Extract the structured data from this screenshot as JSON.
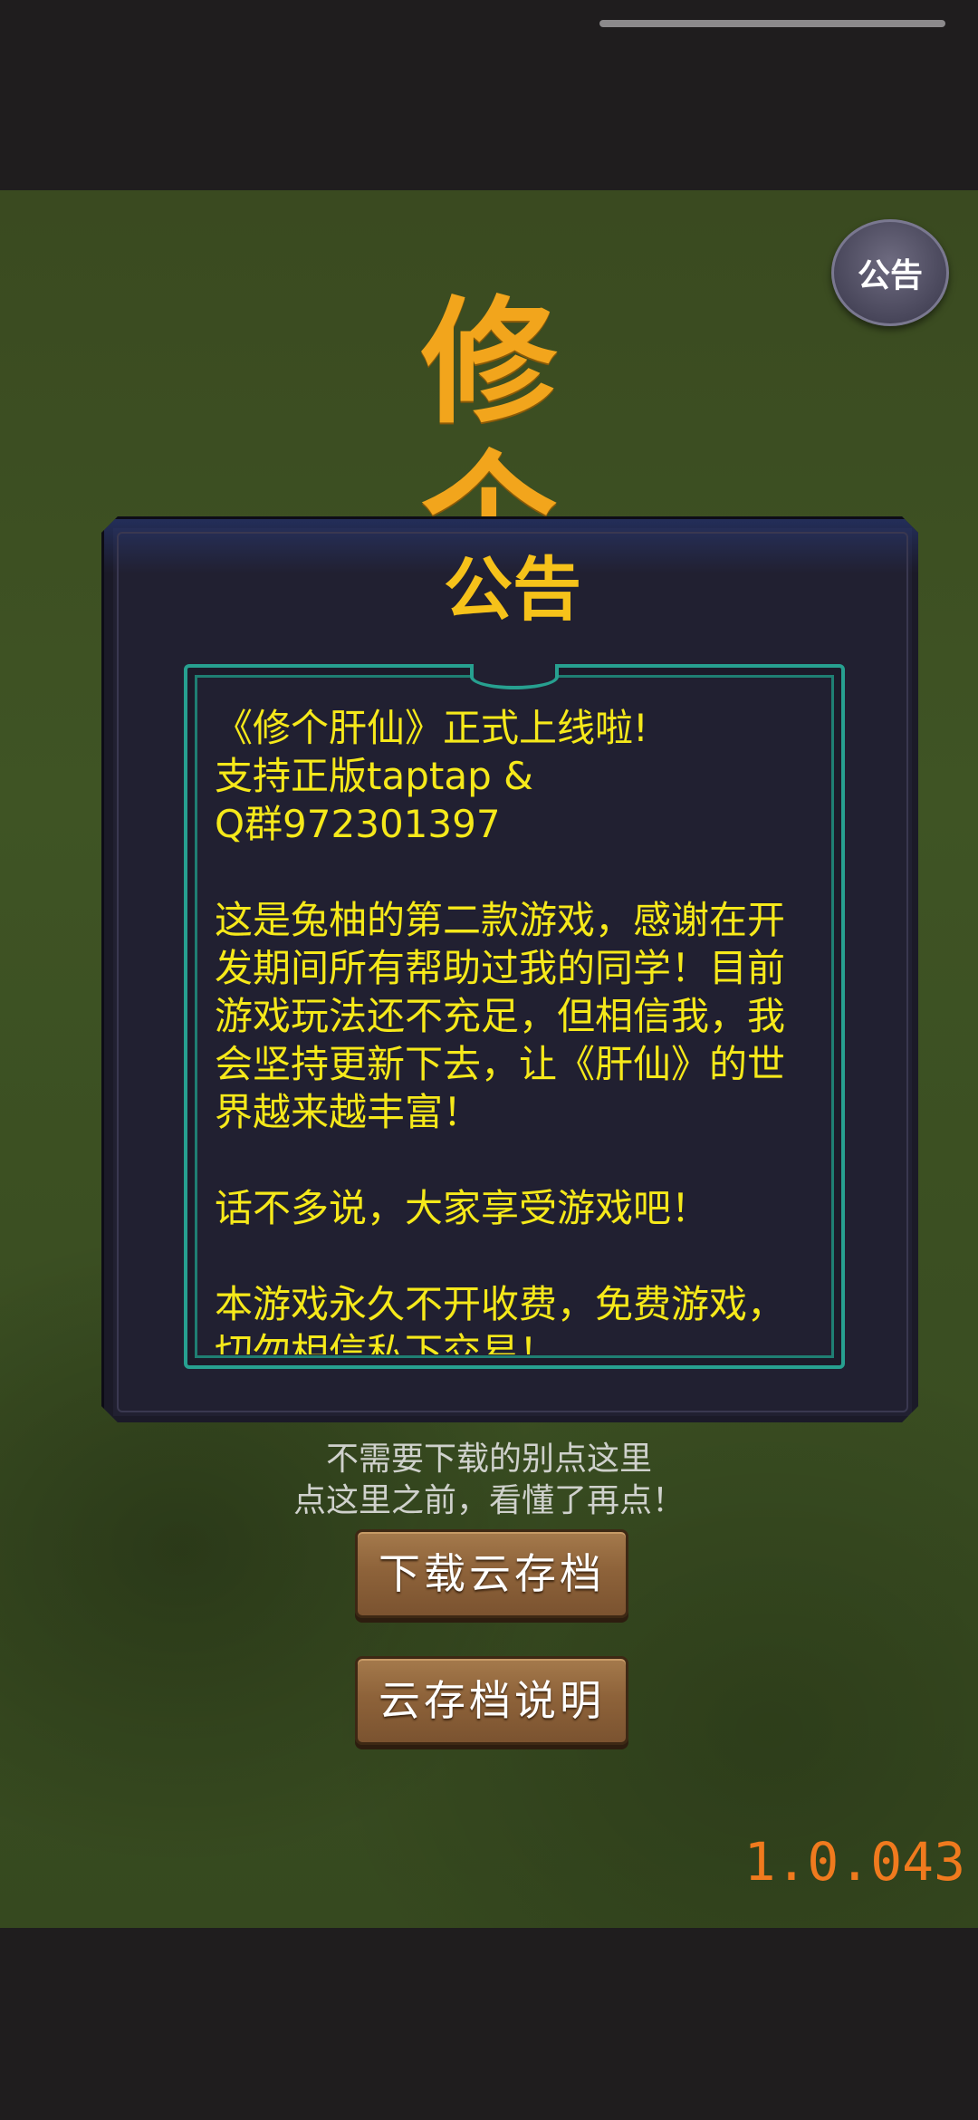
{
  "game": {
    "title_chars": "修个",
    "notice_button_label": "公告",
    "version": "1.0.043"
  },
  "notice_panel": {
    "title": "公告",
    "body": "《修个肝仙》正式上线啦!\n支持正版taptap &\nQ群972301397\n\n这是兔柚的第二款游戏，感谢在开发期间所有帮助过我的同学！目前游戏玩法还不充足，但相信我，我会坚持更新下去，让《肝仙》的世界越来越丰富！\n\n话不多说，大家享受游戏吧！\n\n本游戏永久不开收费，免费游戏，切勿相信私下交易！"
  },
  "hint": {
    "line1": "不需要下载的别点这里",
    "line2": "点这里之前，看懂了再点！"
  },
  "buttons": {
    "download_cloud_save": "下载云存档",
    "cloud_save_info": "云存档说明"
  },
  "colors": {
    "title_orange": "#f2a51c",
    "notice_text_yellow": "#f6e91a",
    "panel_bg": "#212031",
    "frame_teal": "#27a090",
    "version_orange": "#f07a1e"
  },
  "icons": {
    "notice": "notice-round-button"
  }
}
